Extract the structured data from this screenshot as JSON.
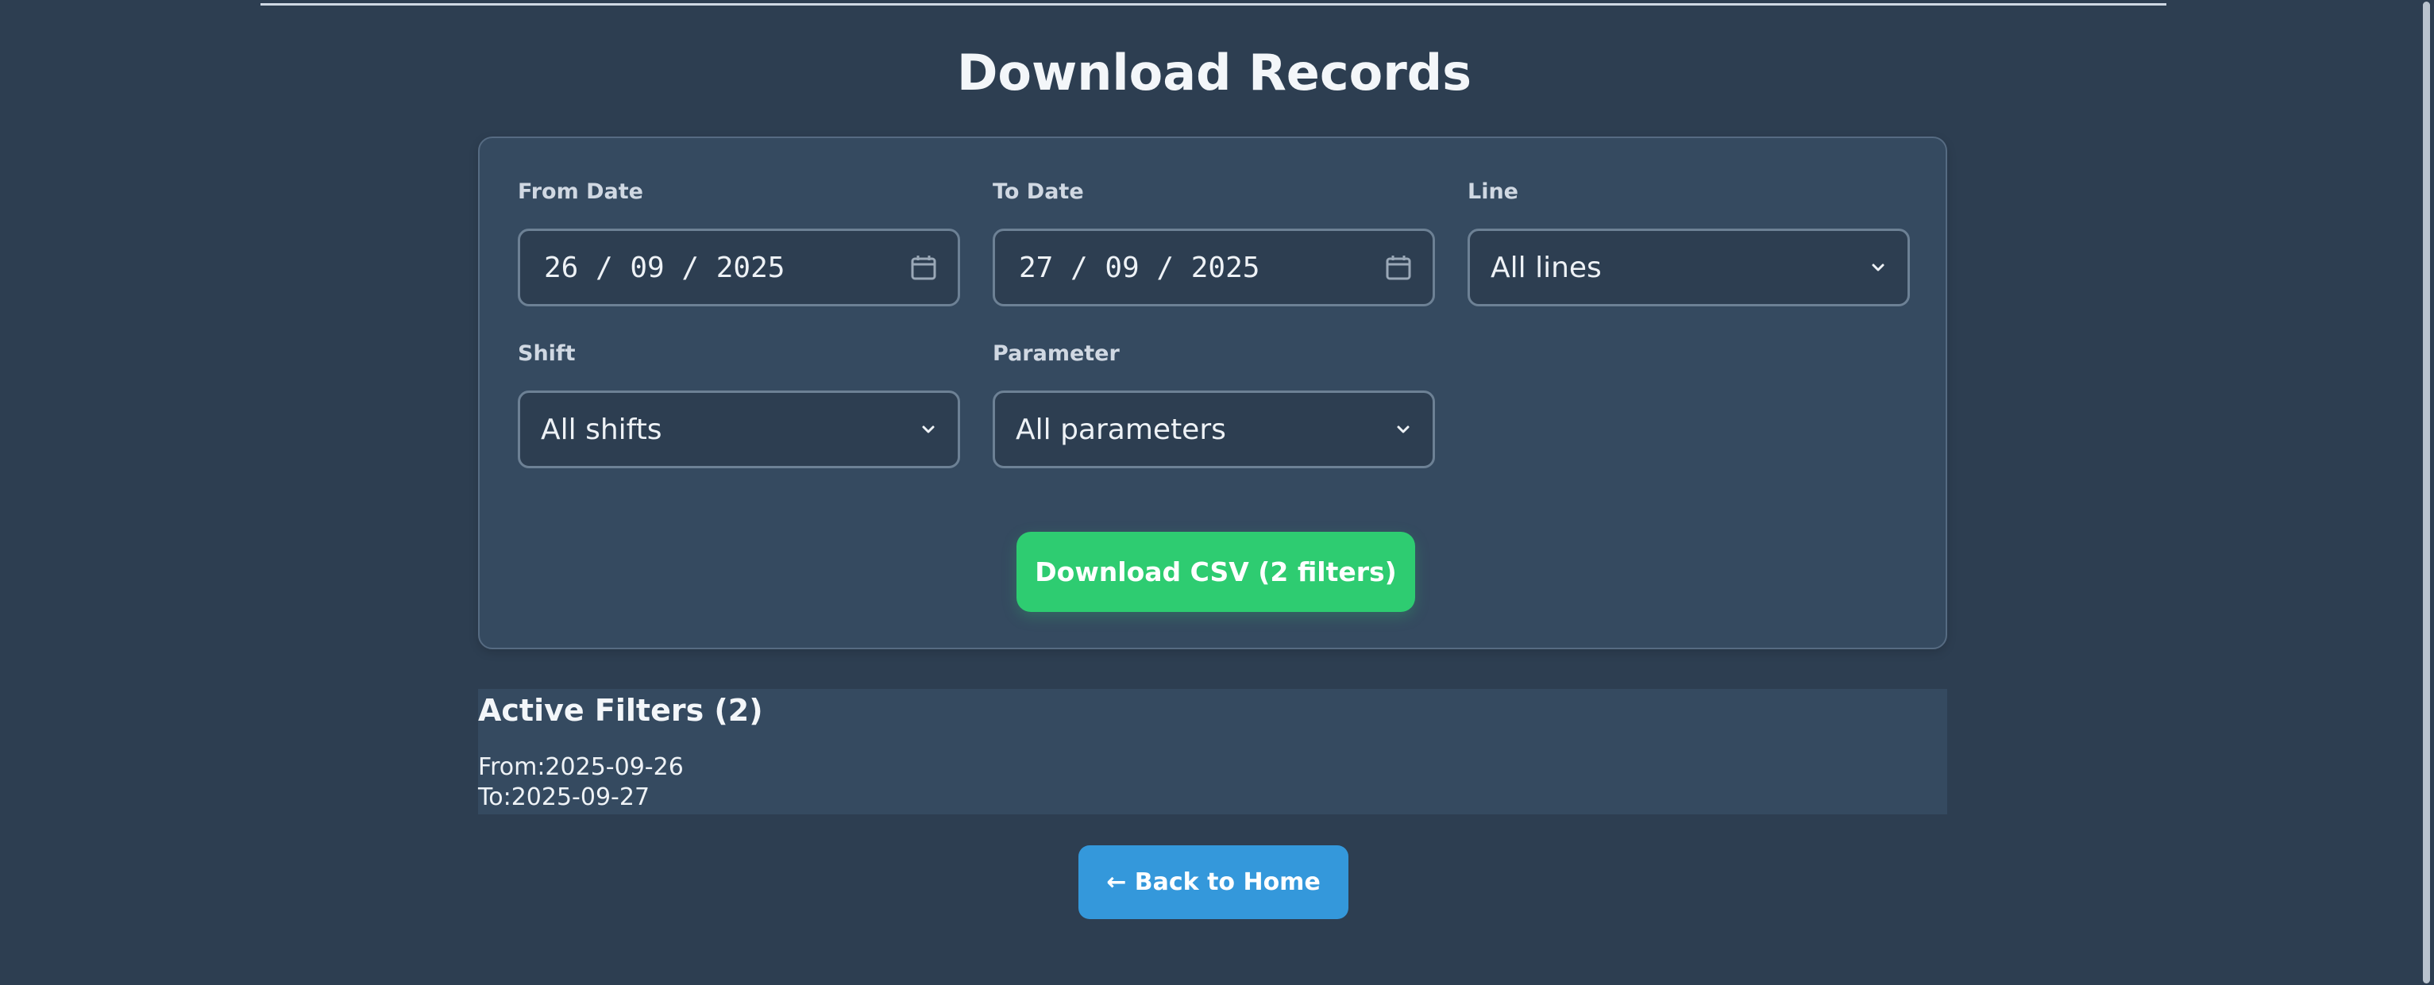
{
  "page": {
    "title": "Download Records"
  },
  "filters": {
    "from_date": {
      "label": "From Date",
      "value": "26 / 09 / 2025",
      "icon": "calendar-icon"
    },
    "to_date": {
      "label": "To Date",
      "value": "27 / 09 / 2025",
      "icon": "calendar-icon"
    },
    "line": {
      "label": "Line",
      "selected": "All lines",
      "icon": "chevron-down-icon"
    },
    "shift": {
      "label": "Shift",
      "selected": "All shifts",
      "icon": "chevron-down-icon"
    },
    "parameter": {
      "label": "Parameter",
      "selected": "All parameters",
      "icon": "chevron-down-icon"
    }
  },
  "actions": {
    "download_label": "Download CSV (2 filters)",
    "back_label": "← Back to Home"
  },
  "active_filters": {
    "title": "Active Filters (2)",
    "items": [
      "From:2025-09-26",
      "To:2025-09-27"
    ]
  },
  "colors": {
    "background": "#2d3e51",
    "card": "#354a60",
    "download_button": "#2ecc71",
    "back_button": "#3498db"
  }
}
